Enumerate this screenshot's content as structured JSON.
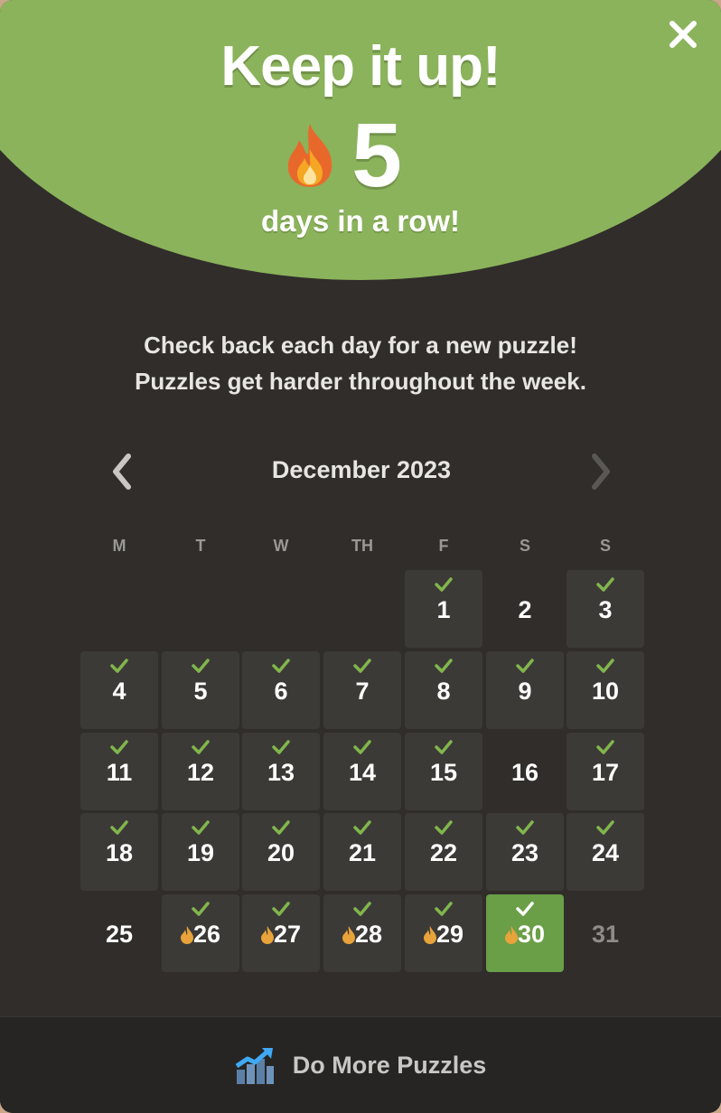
{
  "header": {
    "title": "Keep it up!",
    "streak_count": "5",
    "streak_label": "days in a row!"
  },
  "info": {
    "line1": "Check back each day for a new puzzle!",
    "line2": "Puzzles get harder throughout the week."
  },
  "calendar": {
    "month_label": "December 2023",
    "weekdays": [
      "M",
      "T",
      "W",
      "TH",
      "F",
      "S",
      "S"
    ],
    "weeks": [
      [
        null,
        null,
        null,
        null,
        {
          "day": "1",
          "state": "played"
        },
        {
          "day": "2",
          "state": "missed"
        },
        {
          "day": "3",
          "state": "played"
        }
      ],
      [
        {
          "day": "4",
          "state": "played"
        },
        {
          "day": "5",
          "state": "played"
        },
        {
          "day": "6",
          "state": "played"
        },
        {
          "day": "7",
          "state": "played"
        },
        {
          "day": "8",
          "state": "played"
        },
        {
          "day": "9",
          "state": "played"
        },
        {
          "day": "10",
          "state": "played"
        }
      ],
      [
        {
          "day": "11",
          "state": "played"
        },
        {
          "day": "12",
          "state": "played"
        },
        {
          "day": "13",
          "state": "played"
        },
        {
          "day": "14",
          "state": "played"
        },
        {
          "day": "15",
          "state": "played"
        },
        {
          "day": "16",
          "state": "missed"
        },
        {
          "day": "17",
          "state": "played"
        }
      ],
      [
        {
          "day": "18",
          "state": "played"
        },
        {
          "day": "19",
          "state": "played"
        },
        {
          "day": "20",
          "state": "played"
        },
        {
          "day": "21",
          "state": "played"
        },
        {
          "day": "22",
          "state": "played"
        },
        {
          "day": "23",
          "state": "played"
        },
        {
          "day": "24",
          "state": "played"
        }
      ],
      [
        {
          "day": "25",
          "state": "missed"
        },
        {
          "day": "26",
          "state": "streak"
        },
        {
          "day": "27",
          "state": "streak"
        },
        {
          "day": "28",
          "state": "streak"
        },
        {
          "day": "29",
          "state": "streak"
        },
        {
          "day": "30",
          "state": "today"
        },
        {
          "day": "31",
          "state": "future"
        }
      ]
    ]
  },
  "footer": {
    "button_label": "Do More Puzzles",
    "icon": "trend-chart-icon"
  },
  "icons": {
    "close": "close-icon",
    "prev": "chevron-left-icon",
    "next": "chevron-right-icon",
    "flame": "flame-icon",
    "check": "checkmark-icon"
  },
  "colors": {
    "accent_green": "#8bb35b",
    "today_green": "#6a9e47",
    "check_green": "#81b64c",
    "panel_bg": "#302d2b",
    "cell_bg": "#3c3a37",
    "flame_orange": "#e8a33b"
  }
}
